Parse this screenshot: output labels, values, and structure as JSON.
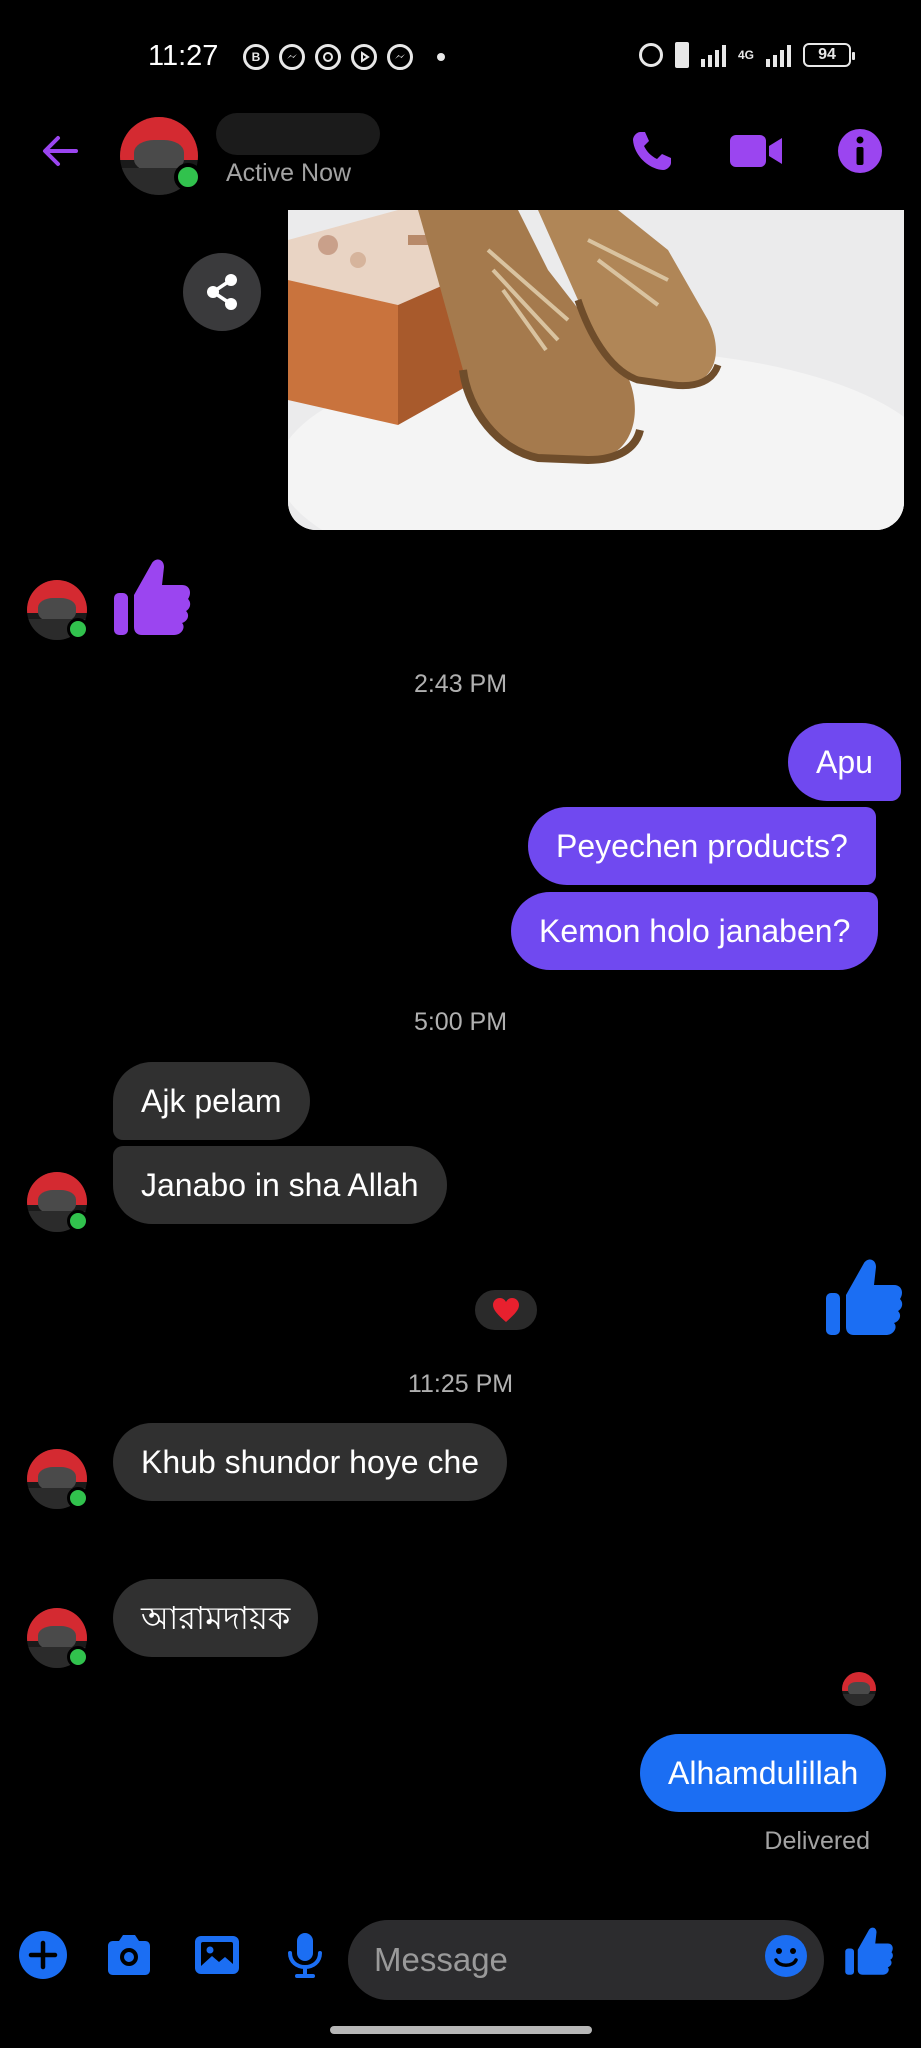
{
  "status_bar": {
    "time": "11:27",
    "app_badge": "B",
    "network": "4G",
    "battery": "94"
  },
  "header": {
    "status": "Active Now",
    "accent_color": "#9b45f0"
  },
  "conversation": {
    "timestamps": [
      "2:43 PM",
      "5:00 PM",
      "11:25 PM"
    ],
    "sent_group_1": [
      "Apu",
      "Peyechen products?",
      "Kemon holo janaben?"
    ],
    "received_group_1": [
      "Ajk pelam",
      "Janabo in sha Allah"
    ],
    "received_2": "Khub shundor hoye che",
    "received_2_reaction": "heart",
    "received_3": "আরামদায়ক",
    "sent_2": "Alhamdulillah",
    "delivery_status": "Delivered"
  },
  "composer": {
    "placeholder": "Message",
    "accent_color": "#1b6ef3"
  },
  "colors": {
    "outgoing_purple": "#7049f0",
    "outgoing_blue": "#1b6ef3",
    "incoming_bubble": "#303030",
    "online": "#31c24d"
  }
}
